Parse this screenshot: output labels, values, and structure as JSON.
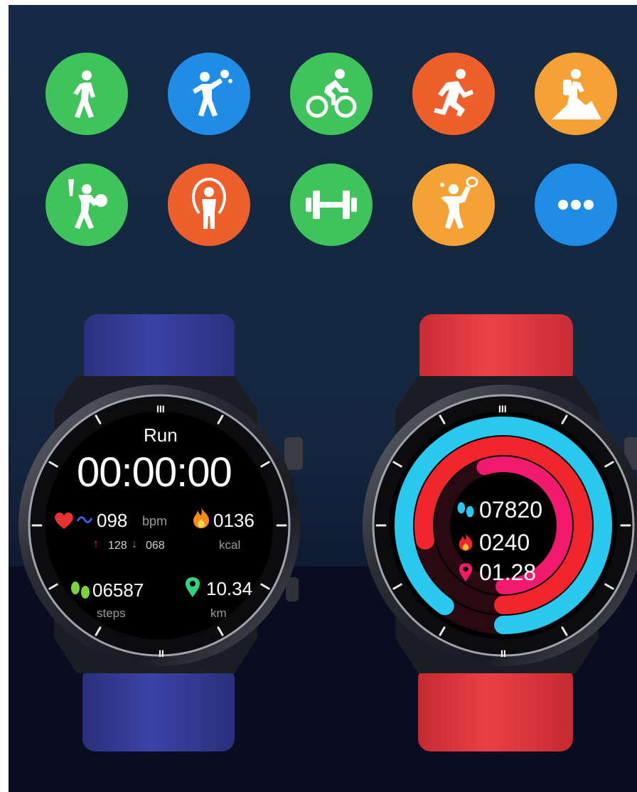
{
  "colors": {
    "green": "#3ec45a",
    "blue": "#1f8ce6",
    "orange_red": "#ee5f2c",
    "orange": "#f5a133",
    "band_left": "#33398f",
    "band_right": "#e03a3f",
    "ring_cyan": "#29c8ee",
    "ring_red": "#f0262c",
    "ring_pink": "#f21a6c"
  },
  "sport_icons": [
    {
      "name": "walking-icon",
      "color": "green"
    },
    {
      "name": "table-tennis-icon",
      "color": "blue"
    },
    {
      "name": "cycling-icon",
      "color": "green"
    },
    {
      "name": "running-icon",
      "color": "orange_red"
    },
    {
      "name": "hiking-icon",
      "color": "orange"
    },
    {
      "name": "baseball-icon",
      "color": "green"
    },
    {
      "name": "jump-rope-icon",
      "color": "orange_red"
    },
    {
      "name": "dumbbell-icon",
      "color": "green"
    },
    {
      "name": "badminton-icon",
      "color": "orange"
    },
    {
      "name": "more-icon",
      "color": "blue"
    }
  ],
  "left_watch": {
    "dial_marks": [
      "III",
      "II"
    ],
    "mode": "Run",
    "timer": "00:00:00",
    "heart_rate": "098",
    "heart_unit": "bpm",
    "hr_max": "128",
    "hr_min": "068",
    "calories": "0136",
    "calories_unit": "kcal",
    "steps": "06587",
    "steps_unit": "steps",
    "distance": "10.34",
    "distance_unit": "km"
  },
  "right_watch": {
    "dial_marks": [
      "III",
      "II"
    ],
    "steps": "07820",
    "calories": "0240",
    "distance": "01.28",
    "ring_progress": {
      "steps": 0.9,
      "calories": 0.78,
      "distance": 0.55
    }
  }
}
